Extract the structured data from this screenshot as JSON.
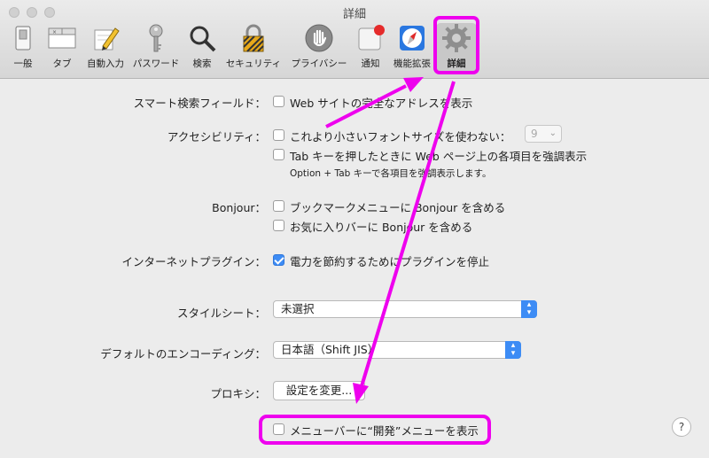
{
  "window": {
    "title": "詳細"
  },
  "toolbar": {
    "items": [
      {
        "label": "一般",
        "icon": "switch-icon"
      },
      {
        "label": "タブ",
        "icon": "tabs-icon"
      },
      {
        "label": "自動入力",
        "icon": "pencil-icon"
      },
      {
        "label": "パスワード",
        "icon": "key-icon"
      },
      {
        "label": "検索",
        "icon": "magnifier-icon"
      },
      {
        "label": "セキュリティ",
        "icon": "padlock-icon"
      },
      {
        "label": "プライバシー",
        "icon": "hand-icon"
      },
      {
        "label": "通知",
        "icon": "notification-icon"
      },
      {
        "label": "機能拡張",
        "icon": "compass-icon"
      },
      {
        "label": "詳細",
        "icon": "gear-icon"
      }
    ]
  },
  "settings": {
    "smart_search": {
      "label": "スマート検索フィールド：",
      "option": "Web サイトの完全なアドレスを表示",
      "checked": false
    },
    "accessibility": {
      "label": "アクセシビリティ：",
      "option1": "これより小さいフォントサイズを使わない：",
      "option1_value": "9",
      "option2": "Tab キーを押したときに Web ページ上の各項目を強調表示",
      "note": "Option + Tab キーで各項目を強調表示します。"
    },
    "bonjour": {
      "label": "Bonjour：",
      "option1": "ブックマークメニューに Bonjour を含める",
      "option2": "お気に入りバーに Bonjour を含める"
    },
    "plugins": {
      "label": "インターネットプラグイン：",
      "option": "電力を節約するためにプラグインを停止",
      "checked": true
    },
    "stylesheet": {
      "label": "スタイルシート：",
      "value": "未選択"
    },
    "encoding": {
      "label": "デフォルトのエンコーディング：",
      "value": "日本語（Shift JIS）"
    },
    "proxy": {
      "label": "プロキシ：",
      "button": "設定を変更..."
    },
    "develop_menu": {
      "option": "メニューバーに“開発”メニューを表示",
      "checked": false
    }
  },
  "help": {
    "label": "?"
  },
  "colors": {
    "annotation": "#ee00ee",
    "accent": "#3d8cf5"
  }
}
